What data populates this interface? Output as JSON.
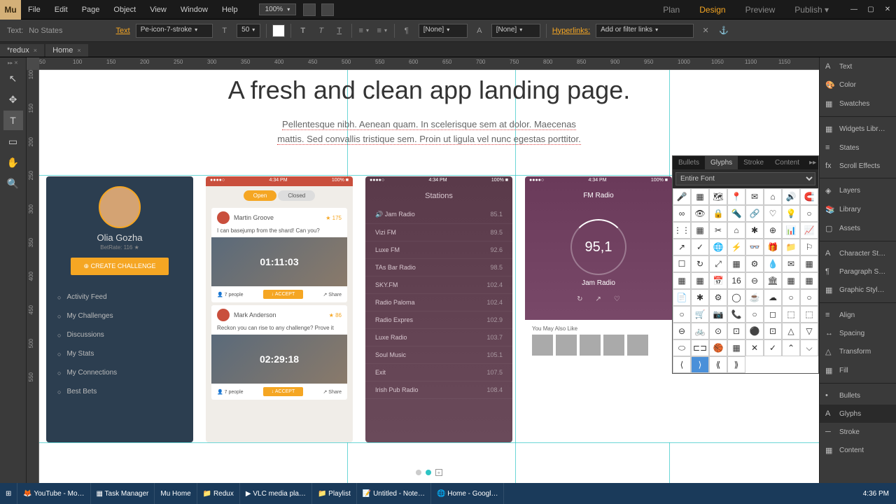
{
  "app": {
    "logo": "Mu"
  },
  "menus": [
    "File",
    "Edit",
    "Page",
    "Object",
    "View",
    "Window",
    "Help"
  ],
  "zoom": "100%",
  "workspace": {
    "items": [
      "Plan",
      "Design",
      "Preview",
      "Publish"
    ],
    "active": 1
  },
  "toolbar": {
    "text_label": "Text:",
    "text_state": "No States",
    "text_link": "Text",
    "font": "Pe-icon-7-stroke",
    "size": "50",
    "align_none1": "[None]",
    "align_none2": "[None]",
    "hyperlinks_label": "Hyperlinks:",
    "hyperlinks_value": "Add or filter links"
  },
  "tabs": [
    {
      "label": "*redux",
      "close": "×"
    },
    {
      "label": "Home",
      "close": "×"
    }
  ],
  "ruler_h": [
    "50",
    "100",
    "150",
    "200",
    "250",
    "300",
    "350",
    "400",
    "450",
    "500",
    "550",
    "600",
    "650",
    "700",
    "750",
    "800",
    "850",
    "900",
    "950",
    "1000",
    "1050",
    "1100",
    "1150"
  ],
  "ruler_v": [
    "100",
    "150",
    "200",
    "250",
    "300",
    "350",
    "400",
    "450",
    "500",
    "550"
  ],
  "page": {
    "headline": "A fresh and clean app landing page.",
    "sub1": "Pellentesque nibh. Aenean quam. In scelerisque sem at dolor. Maecenas",
    "sub2": "mattis. Sed convallis tristique sem. Proin ut ligula vel nunc egestas porttitor."
  },
  "mock1": {
    "name": "Olia Gozha",
    "betrate": "BetRate: 116 ★",
    "cta": "⊕ CREATE CHALLENGE",
    "items": [
      "Activity Feed",
      "My Challenges",
      "Discussions",
      "My Stats",
      "My Connections",
      "Best Bets"
    ]
  },
  "mock2": {
    "sb_left": "●●●●○",
    "sb_time": "4:34 PM",
    "sb_right": "100% ■",
    "tab_on": "Open",
    "tab_off": "Closed",
    "c1_name": "Martin Groove",
    "c1_stars": "★ 175",
    "c1_q": "I can basejump from the shard! Can you?",
    "c1_time": "01:11:03",
    "people": "👤 7 people",
    "accept": "↓ ACCEPT",
    "share": "↗ Share",
    "c2_name": "Mark Anderson",
    "c2_stars": "★ 86",
    "c2_q": "Reckon you can rise to any challenge? Prove it",
    "c2_time": "02:29:18"
  },
  "mock3": {
    "title": "Stations",
    "rows": [
      [
        "🔊 Jam Radio",
        "85.1"
      ],
      [
        "Vizi FM",
        "89.5"
      ],
      [
        "Luxe FM",
        "92.6"
      ],
      [
        "TAs Bar Radio",
        "98.5"
      ],
      [
        "SKY.FM",
        "102.4"
      ],
      [
        "Radio Paloma",
        "102.4"
      ],
      [
        "Radio Expres",
        "102.9"
      ],
      [
        "Luxe Radio",
        "103.7"
      ],
      [
        "Soul Music",
        "105.1"
      ],
      [
        "Exit",
        "107.5"
      ],
      [
        "Irish Pub Radio",
        "108.4"
      ]
    ]
  },
  "mock4": {
    "title": "FM Radio",
    "freq": "95,1",
    "station": "Jam Radio",
    "youmay": "You May Also Like"
  },
  "glyphs": {
    "tabs": [
      "Bullets",
      "Glyphs",
      "Stroke",
      "Content"
    ],
    "active": 1,
    "select": "Entire Font",
    "icons": [
      "🎤",
      "▦",
      "🗺",
      "📍",
      "✉",
      "⌂",
      "🔊",
      "🧲",
      "∞",
      "👁",
      "🔒",
      "🔦",
      "🔗",
      "♡",
      "💡",
      "○",
      "⋮⋮",
      "▦",
      "✂",
      "⌂",
      "✱",
      "⊕",
      "📊",
      "📈",
      "↗",
      "✓",
      "🌐",
      "⚡",
      "👓",
      "🎁",
      "📁",
      "⚐",
      "☐",
      "↻",
      "⤢",
      "▦",
      "⚙",
      "💧",
      "✉",
      "▦",
      "▦",
      "▦",
      "📅",
      "16",
      "⊖",
      "🏛",
      "▦",
      "▦",
      "📄",
      "✱",
      "⚙",
      "◯",
      "☕",
      "☁",
      "○",
      "○",
      "○",
      "🛒",
      "📷",
      "📞",
      "○",
      "◻",
      "⬚",
      "⬚",
      "⊖",
      "🚲",
      "⊙",
      "⊡",
      "⚫",
      "⊡",
      "△",
      "▽",
      "⬭",
      "⊏⊐",
      "🏀",
      "▦",
      "✕",
      "✓",
      "⌃",
      "⌵",
      "⟨",
      "⟩",
      "⟪",
      "⟫"
    ]
  },
  "rightPanels": [
    {
      "ic": "A",
      "label": "Text"
    },
    {
      "ic": "🎨",
      "label": "Color"
    },
    {
      "ic": "▦",
      "label": "Swatches"
    },
    {
      "sep": true
    },
    {
      "ic": "▦",
      "label": "Widgets Libr…"
    },
    {
      "ic": "≡",
      "label": "States"
    },
    {
      "ic": "fx",
      "label": "Scroll Effects"
    },
    {
      "sep": true
    },
    {
      "ic": "◈",
      "label": "Layers"
    },
    {
      "ic": "📚",
      "label": "Library"
    },
    {
      "ic": "▢",
      "label": "Assets"
    },
    {
      "sep": true
    },
    {
      "ic": "A",
      "label": "Character St…"
    },
    {
      "ic": "¶",
      "label": "Paragraph S…"
    },
    {
      "ic": "▦",
      "label": "Graphic Styl…"
    },
    {
      "sep": true
    },
    {
      "ic": "≡",
      "label": "Align"
    },
    {
      "ic": "↔",
      "label": "Spacing"
    },
    {
      "ic": "△",
      "label": "Transform"
    },
    {
      "ic": "▦",
      "label": "Fill"
    },
    {
      "sep": true
    },
    {
      "ic": "•",
      "label": "Bullets"
    },
    {
      "ic": "A",
      "label": "Glyphs",
      "on": true
    },
    {
      "ic": "─",
      "label": "Stroke"
    },
    {
      "ic": "▦",
      "label": "Content"
    }
  ],
  "taskbar": {
    "items": [
      "⊞",
      "🦊 YouTube - Mo…",
      "▦ Task Manager",
      "Mu Home",
      "📁 Redux",
      "▶ VLC media pla…",
      "📁 Playlist",
      "📝 Untitled - Note…",
      "🌐 Home - Googl…"
    ],
    "clock": "4:36 PM"
  }
}
